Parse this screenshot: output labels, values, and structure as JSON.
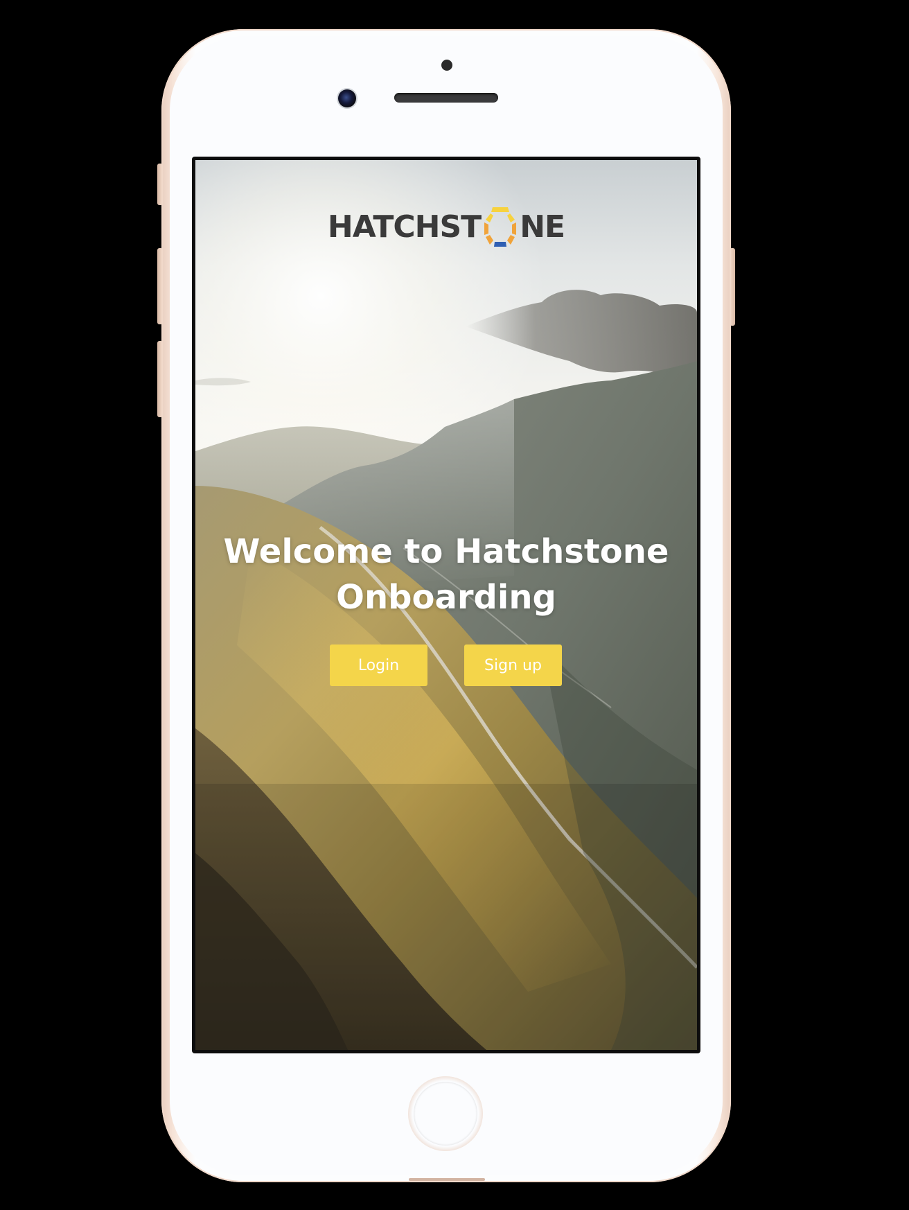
{
  "app": {
    "logo_text_left": "HATCHST",
    "logo_text_right": "NE",
    "welcome_line1": "Welcome to Hatchstone",
    "welcome_line2": "Onboarding",
    "buttons": {
      "login_label": "Login",
      "signup_label": "Sign up"
    },
    "colors": {
      "accent_yellow": "#f4d54a",
      "logo_dark": "#3a3a3a",
      "logo_orange": "#f0a33a",
      "logo_yellow": "#f7d23e",
      "logo_blue": "#2f5fb3"
    }
  },
  "device": {
    "type": "iPhone",
    "finish": "rose gold / white"
  }
}
